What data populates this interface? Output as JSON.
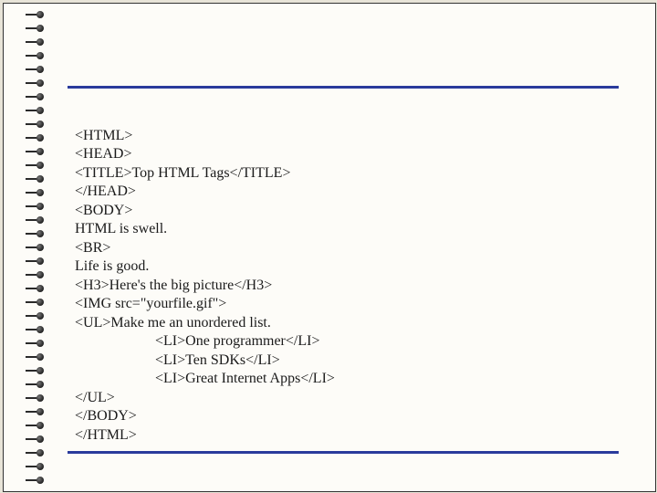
{
  "code_lines": [
    "<HTML>",
    "<HEAD>",
    "<TITLE>Top HTML Tags</TITLE>",
    "</HEAD>",
    "<BODY>",
    "HTML is swell.",
    "<BR>",
    "Life is good.",
    "<H3>Here's the big picture</H3>",
    "<IMG src=\"yourfile.gif\">",
    "<UL>Make me an unordered list.",
    "        <LI>One programmer</LI>",
    "        <LI>Ten SDKs</LI>",
    "        <LI>Great Internet Apps</LI>",
    "</UL>",
    "</BODY>",
    "</HTML>"
  ]
}
